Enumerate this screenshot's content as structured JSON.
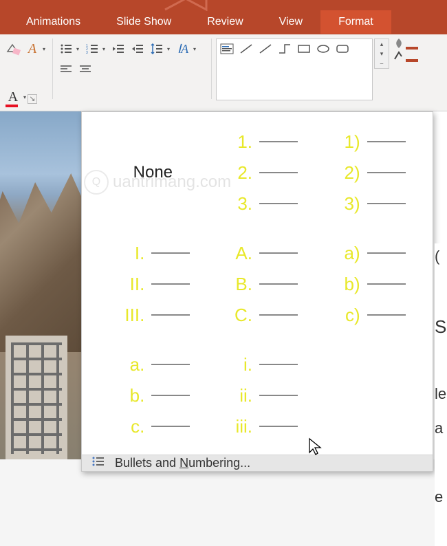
{
  "ribbon_tabs": {
    "animations": "Animations",
    "slide_show": "Slide Show",
    "review": "Review",
    "view": "View",
    "format": "Format"
  },
  "ribbon": {
    "shape_fill_color": "#b7472a",
    "shape_outline_color": "#b7472a"
  },
  "numbering_panel": {
    "none": "None",
    "formats": [
      {
        "id": "decimal-dot",
        "items": [
          "1.",
          "2.",
          "3."
        ]
      },
      {
        "id": "decimal-paren",
        "items": [
          "1)",
          "2)",
          "3)"
        ]
      },
      {
        "id": "upper-roman",
        "items": [
          "I.",
          "II.",
          "III."
        ]
      },
      {
        "id": "upper-alpha",
        "items": [
          "A.",
          "B.",
          "C."
        ]
      },
      {
        "id": "lower-alpha-paren",
        "items": [
          "a)",
          "b)",
          "c)"
        ]
      },
      {
        "id": "lower-alpha",
        "items": [
          "a.",
          "b.",
          "c."
        ]
      },
      {
        "id": "lower-roman",
        "items": [
          "i.",
          "ii.",
          "iii."
        ]
      }
    ],
    "footer_prefix": "Bullets and ",
    "footer_u": "N",
    "footer_suffix": "umbering..."
  },
  "watermark": {
    "icon": "Q",
    "text": "uantrimang.com"
  },
  "slide_text_chars": [
    "(",
    "",
    "S",
    "",
    "le",
    "a",
    "",
    "e"
  ]
}
